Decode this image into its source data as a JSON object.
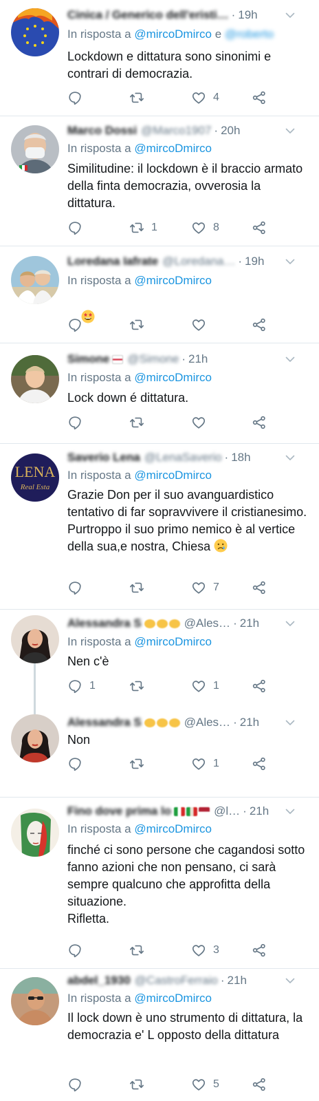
{
  "common": {
    "reply_prefix": "In risposta a",
    "separator": "·"
  },
  "colors": {
    "link": "#1b95e0",
    "muted": "#657786",
    "divider": "#e1e8ed"
  },
  "tweets": [
    {
      "name": "Cinica / Generico dell'eristi…",
      "handle": "",
      "time": "19h",
      "reply_to": "@mircoDmirco",
      "reply_to_extra": "e",
      "reply_to_second": "@roberto",
      "text": "Lockdown e dittatura sono sinonimi e contrari di democrazia.",
      "replies": "",
      "retweets": "",
      "likes": "4",
      "avatar_icon": "eu-flag-fire-avatar"
    },
    {
      "name": "Marco Dossi",
      "handle": "@Marco1907",
      "time": "20h",
      "reply_to": "@mircoDmirco",
      "text": "Similitudine: il lockdown è il braccio armato della finta democrazia, ovverosia la dittatura.",
      "replies": "",
      "retweets": "1",
      "likes": "8",
      "avatar_icon": "man-with-mask-avatar"
    },
    {
      "name": "Loredana Iafrate",
      "handle": "@Loredana…",
      "time": "19h",
      "reply_to": "@mircoDmirco",
      "text": "",
      "replies": "",
      "retweets": "",
      "likes": "",
      "emoji": "star-struck-emoji",
      "avatar_icon": "two-people-avatar"
    },
    {
      "name": "Simone",
      "handle": "@Simone",
      "time": "21h",
      "reply_to": "@mircoDmirco",
      "text": "Lock down é dittatura.",
      "replies": "",
      "retweets": "",
      "likes": "",
      "avatar_icon": "young-man-avatar"
    },
    {
      "name": "Saverio Lena",
      "handle": "@LenaSaverio",
      "time": "18h",
      "reply_to": "@mircoDmirco",
      "text": "Grazie Don per il suo avanguardistico tentativo di far sopravvivere il cristianesimo.   Purtroppo il suo primo nemico è al vertice della sua,e nostra, Chiesa",
      "replies": "",
      "retweets": "",
      "likes": "7",
      "emoji": "sad-face-emoji",
      "avatar_text": "LENA",
      "avatar_subtext": "Real Esta",
      "avatar_icon": "lena-logo-avatar"
    },
    {
      "name": "Alessandra S",
      "handle": "@Ales…",
      "time": "21h",
      "reply_to": "@mircoDmirco",
      "text": "Nen c'è",
      "replies": "1",
      "retweets": "",
      "likes": "1",
      "avatar_icon": "woman-dark-hair-avatar"
    },
    {
      "name": "Alessandra S",
      "handle": "@Ales…",
      "time": "21h",
      "reply_to": "",
      "text": "Non",
      "replies": "",
      "retweets": "",
      "likes": "1",
      "avatar_icon": "woman-dark-hair-avatar"
    },
    {
      "name": "Fino dove prima lo",
      "handle": "@l…",
      "time": "21h",
      "reply_to": "@mircoDmirco",
      "text": "finché ci sono persone che cagandosi sotto fanno azioni che non pensano, ci sarà sempre qualcuno che approfitta della situazione.\nRifletta.",
      "replies": "",
      "retweets": "",
      "likes": "3",
      "avatar_icon": "italian-flag-face-avatar"
    },
    {
      "name": "abdel_1930",
      "handle": "@CastroFerraio",
      "time": "21h",
      "reply_to": "@mircoDmirco",
      "text": "Il lock down è uno strumento di dittatura, la democrazia e' L opposto della dittatura",
      "replies": "",
      "retweets": "",
      "likes": "5",
      "avatar_icon": "man-sunglasses-avatar"
    }
  ]
}
